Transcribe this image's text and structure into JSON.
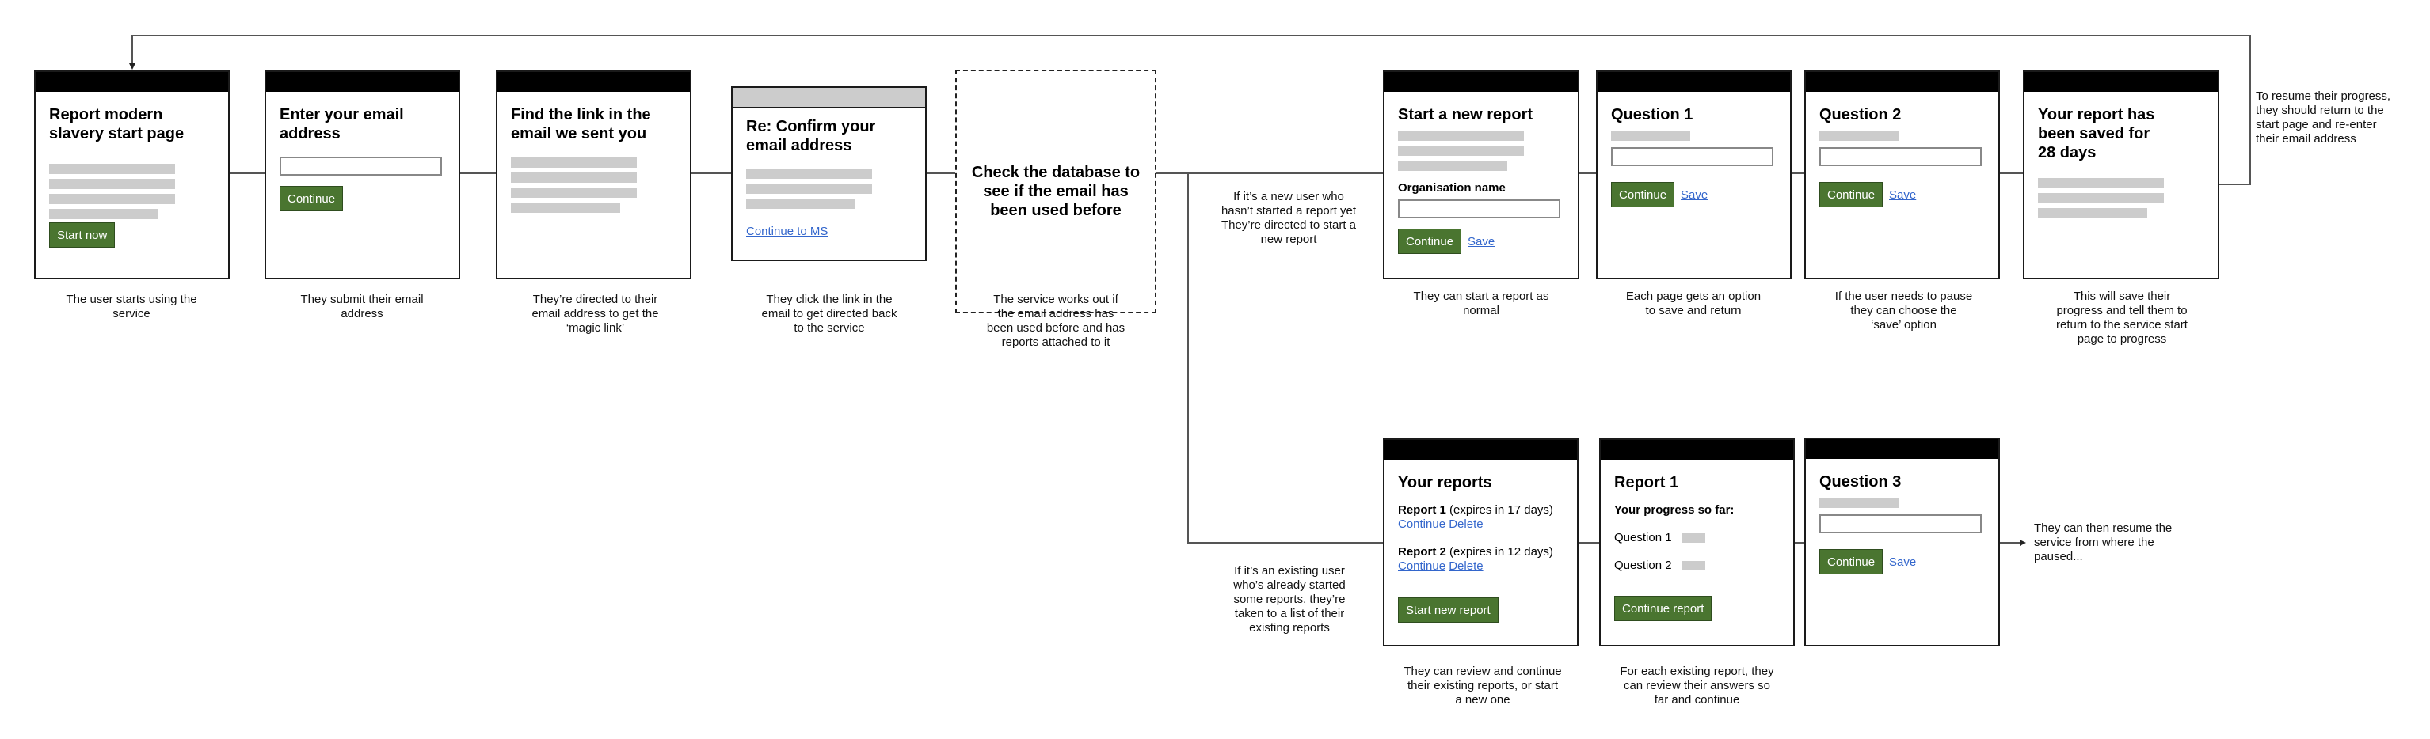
{
  "colors": {
    "button_green": "#4a7530",
    "link_blue": "#3366cc",
    "placeholder_grey": "#cccccc",
    "header_black": "#000000"
  },
  "cards": {
    "start_page": {
      "title": "Report modern slavery start page",
      "button": "Start now",
      "caption": "The user starts using the service"
    },
    "enter_email": {
      "title": "Enter your email address",
      "button": "Continue",
      "caption": "They submit their email address"
    },
    "find_link": {
      "title": "Find the link in the email we sent you",
      "caption": "They’re directed to their email address to get the ‘magic link’"
    },
    "confirm_email": {
      "title": "Re: Confirm your email address",
      "link": "Continue to MS",
      "caption": "They click the link in the email to get directed back to the service"
    },
    "check_database": {
      "title": "Check the database to see if the email has been used before",
      "caption": "The service works out if the email address has been used before and has reports attached to it"
    },
    "start_new_report": {
      "title": "Start a new report",
      "field_label": "Organisation name",
      "button": "Continue",
      "link": "Save",
      "caption": "They can start a report as normal"
    },
    "question_1": {
      "title": "Question 1",
      "button": "Continue",
      "link": "Save",
      "caption": "Each page gets an option to save and return"
    },
    "question_2": {
      "title": "Question 2",
      "button": "Continue",
      "link": "Save",
      "caption": "If the user needs to pause they can choose the ‘save’ option"
    },
    "saved": {
      "title": "Your report has been saved for 28 days",
      "caption": "This will save their progress and tell them to return to the service start page to progress"
    },
    "your_reports": {
      "title": "Your reports",
      "reports": [
        {
          "name": "Report 1",
          "expiry": "(expires in 17 days)",
          "continue": "Continue",
          "delete": "Delete"
        },
        {
          "name": "Report 2",
          "expiry": "(expires in 12 days)",
          "continue": "Continue",
          "delete": "Delete"
        }
      ],
      "button": "Start new report",
      "caption": "They can review and continue their existing reports, or start a new one"
    },
    "report_1": {
      "title": "Report 1",
      "subtitle": "Your progress so far:",
      "questions": [
        "Question 1",
        "Question 2"
      ],
      "button": "Continue report",
      "caption": "For each existing report, they can review their answers so far and continue"
    },
    "question_3": {
      "title": "Question 3",
      "button": "Continue",
      "link": "Save"
    }
  },
  "notes": {
    "new_user": "If it’s a new user who hasn’t started a report yet They’re directed to start a new report",
    "existing_user": "If it’s an existing user who’s already started some reports, they’re taken to a list of their existing reports",
    "resume_progress": "To resume their progress, they should return to the start page and re-enter their email address",
    "resume_service": "They can then resume the service from where the paused..."
  }
}
